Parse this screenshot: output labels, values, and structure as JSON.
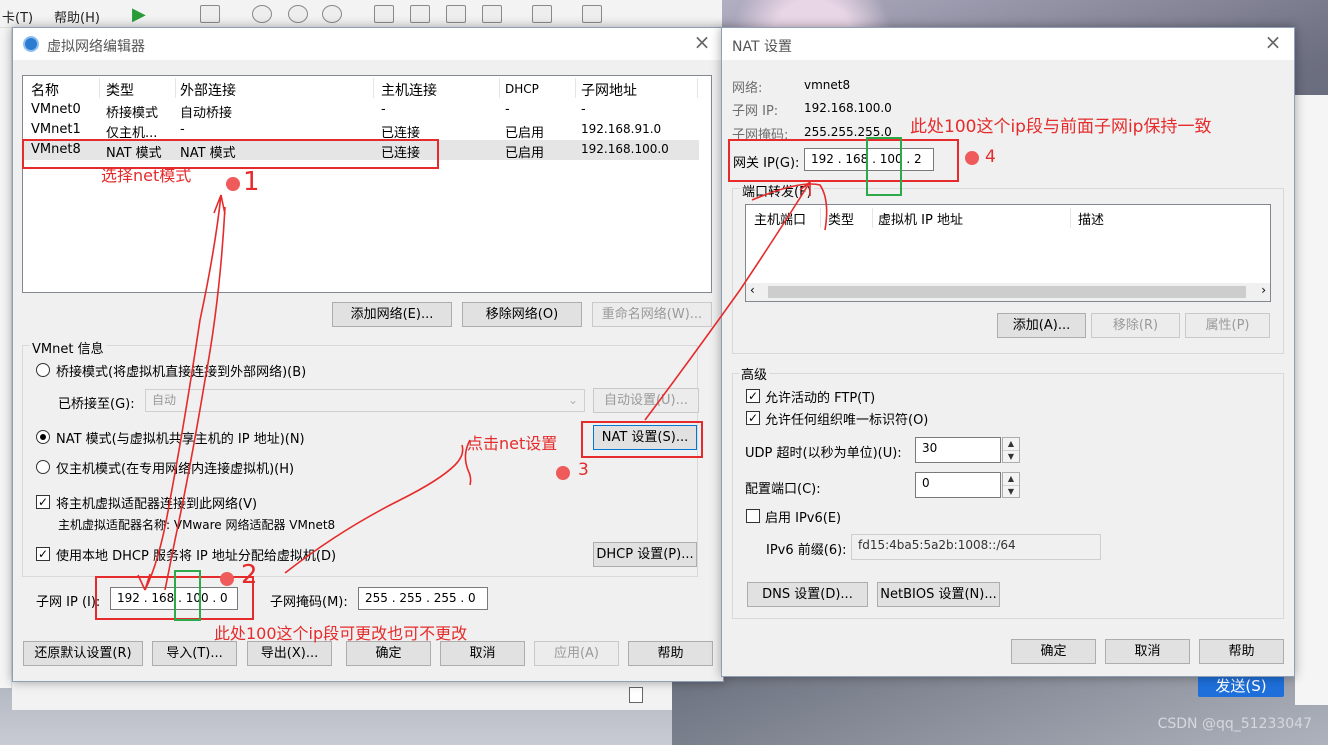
{
  "background": {
    "menu": [
      "卡(T)",
      "帮助(H)"
    ],
    "send_button": "发送(S)",
    "watermark": "CSDN @qq_51233047"
  },
  "left_dialog": {
    "title": "虚拟网络编辑器",
    "columns": [
      "名称",
      "类型",
      "外部连接",
      "主机连接",
      "DHCP",
      "子网地址"
    ],
    "rows": [
      {
        "name": "VMnet0",
        "type": "桥接模式",
        "external": "自动桥接",
        "host": "-",
        "dhcp": "-",
        "subnet": "-"
      },
      {
        "name": "VMnet1",
        "type": "仅主机...",
        "external": "-",
        "host": "已连接",
        "dhcp": "已启用",
        "subnet": "192.168.91.0"
      },
      {
        "name": "VMnet8",
        "type": "NAT 模式",
        "external": "NAT 模式",
        "host": "已连接",
        "dhcp": "已启用",
        "subnet": "192.168.100.0"
      }
    ],
    "buttons_row1": {
      "add": "添加网络(E)...",
      "remove": "移除网络(O)",
      "rename": "重命名网络(W)..."
    },
    "vmnet_info": "VMnet 信息",
    "bridged_radio": "桥接模式(将虚拟机直接连接到外部网络)(B)",
    "bridged_to_label": "已桥接至(G):",
    "bridged_to_value": "自动",
    "auto_settings": "自动设置(U)...",
    "nat_radio": "NAT 模式(与虚拟机共享主机的 IP 地址)(N)",
    "nat_settings": "NAT 设置(S)...",
    "hostonly_radio": "仅主机模式(在专用网络内连接虚拟机)(H)",
    "connect_adapter": "将主机虚拟适配器连接到此网络(V)",
    "adapter_name": "主机虚拟适配器名称: VMware 网络适配器 VMnet8",
    "use_dhcp": "使用本地 DHCP 服务将 IP 地址分配给虚拟机(D)",
    "dhcp_settings": "DHCP 设置(P)...",
    "subnet_ip_label": "子网 IP (I):",
    "subnet_ip": "192 . 168 . 100 .  0",
    "subnet_mask_label": "子网掩码(M):",
    "subnet_mask": "255 . 255 . 255 .  0",
    "bottom_buttons": {
      "restore": "还原默认设置(R)",
      "import": "导入(T)...",
      "export": "导出(X)...",
      "ok": "确定",
      "cancel": "取消",
      "apply": "应用(A)",
      "help": "帮助"
    }
  },
  "right_dialog": {
    "title": "NAT 设置",
    "network_label": "网络:",
    "network_value": "vmnet8",
    "subnet_ip_label": "子网 IP:",
    "subnet_ip_value": "192.168.100.0",
    "subnet_mask_label": "子网掩码:",
    "subnet_mask_value": "255.255.255.0",
    "gateway_label": "网关 IP(G):",
    "gateway_value": "192 . 168 . 100 .  2",
    "port_forward_label": "端口转发(F)",
    "pf_columns": [
      "主机端口",
      "类型",
      "虚拟机 IP 地址",
      "描述"
    ],
    "pf_buttons": {
      "add": "添加(A)...",
      "remove": "移除(R)",
      "props": "属性(P)"
    },
    "advanced_label": "高级",
    "allow_ftp": "允许活动的 FTP(T)",
    "allow_uid": "允许任何组织唯一标识符(O)",
    "udp_label": "UDP 超时(以秒为单位)(U):",
    "udp_value": "30",
    "config_port_label": "配置端口(C):",
    "config_port_value": "0",
    "ipv6_enable": "启用 IPv6(E)",
    "ipv6_prefix_label": "IPv6 前缀(6):",
    "ipv6_prefix_value": "fd15:4ba5:5a2b:1008::/64",
    "dns_btn": "DNS 设置(D)...",
    "netbios_btn": "NetBIOS 设置(N)...",
    "ok": "确定",
    "cancel": "取消",
    "help": "帮助"
  },
  "annotations": {
    "select_nat": "选择net模式",
    "step1": "1",
    "step2": "2",
    "step3": "3",
    "step4": "4",
    "click_nat": "点击net设置",
    "left_note": "此处100这个ip段可更改也可不更改",
    "right_note": "此处100这个ip段与前面子网ip保持一致"
  }
}
